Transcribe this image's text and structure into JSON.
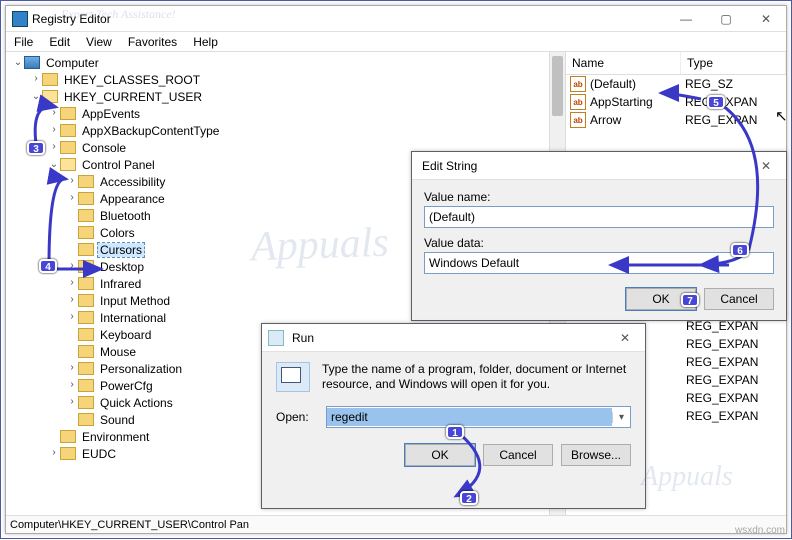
{
  "regedit": {
    "title": "Registry Editor",
    "menus": [
      "File",
      "Edit",
      "View",
      "Favorites",
      "Help"
    ],
    "statusbar": "Computer\\HKEY_CURRENT_USER\\Control Pan",
    "tree": {
      "root": "Computer",
      "hives": [
        {
          "label": "HKEY_CLASSES_ROOT",
          "exp": ">"
        },
        {
          "label": "HKEY_CURRENT_USER",
          "exp": "v",
          "children": [
            {
              "label": "AppEvents",
              "exp": ">"
            },
            {
              "label": "AppXBackupContentType",
              "exp": ">"
            },
            {
              "label": "Console",
              "exp": ">"
            },
            {
              "label": "Control Panel",
              "exp": "v",
              "children": [
                {
                  "label": "Accessibility",
                  "exp": ">"
                },
                {
                  "label": "Appearance",
                  "exp": ">"
                },
                {
                  "label": "Bluetooth",
                  "exp": ""
                },
                {
                  "label": "Colors",
                  "exp": ""
                },
                {
                  "label": "Cursors",
                  "exp": "",
                  "sel": true
                },
                {
                  "label": "Desktop",
                  "exp": ">"
                },
                {
                  "label": "Infrared",
                  "exp": ">"
                },
                {
                  "label": "Input Method",
                  "exp": ">"
                },
                {
                  "label": "International",
                  "exp": ">"
                },
                {
                  "label": "Keyboard",
                  "exp": ""
                },
                {
                  "label": "Mouse",
                  "exp": ""
                },
                {
                  "label": "Personalization",
                  "exp": ">"
                },
                {
                  "label": "PowerCfg",
                  "exp": ">"
                },
                {
                  "label": "Quick Actions",
                  "exp": ">"
                },
                {
                  "label": "Sound",
                  "exp": ""
                }
              ]
            },
            {
              "label": "Environment",
              "exp": ""
            },
            {
              "label": "EUDC",
              "exp": ">"
            }
          ]
        }
      ]
    },
    "values_header": {
      "name": "Name",
      "type": "Type"
    },
    "values_top": [
      {
        "name": "(Default)",
        "type": "REG_SZ",
        "icon": "ab"
      },
      {
        "name": "AppStarting",
        "type": "REG_EXPAN",
        "icon": "ab"
      },
      {
        "name": "Arrow",
        "type": "REG_EXPAN",
        "icon": "ab"
      }
    ],
    "values_bottom": [
      {
        "type": "REG_EXPAN"
      },
      {
        "type": "REG_EXPAN"
      },
      {
        "type": "REG_EXPAN"
      },
      {
        "type": "REG_EXPAN"
      },
      {
        "type": "REG_EXPAN"
      },
      {
        "type": "REG_EXPAN"
      },
      {
        "type": "REG_EXPAN"
      }
    ]
  },
  "editstr": {
    "title": "Edit String",
    "valname_label": "Value name:",
    "valname": "(Default)",
    "valdata_label": "Value data:",
    "valdata": "Windows Default",
    "ok": "OK",
    "cancel": "Cancel"
  },
  "rundlg": {
    "title": "Run",
    "desc": "Type the name of a program, folder, document or Internet resource, and Windows will open it for you.",
    "open_label": "Open:",
    "open_value": "regedit",
    "ok": "OK",
    "cancel": "Cancel",
    "browse": "Browse..."
  },
  "annotations": {
    "b1": "1",
    "b2": "2",
    "b3": "3",
    "b4": "4",
    "b5": "5",
    "b6": "6",
    "b7": "7",
    "source": "wsxdn.com",
    "wm_small": "Expert Tech Assistance!",
    "wm_big": "Appuals"
  }
}
